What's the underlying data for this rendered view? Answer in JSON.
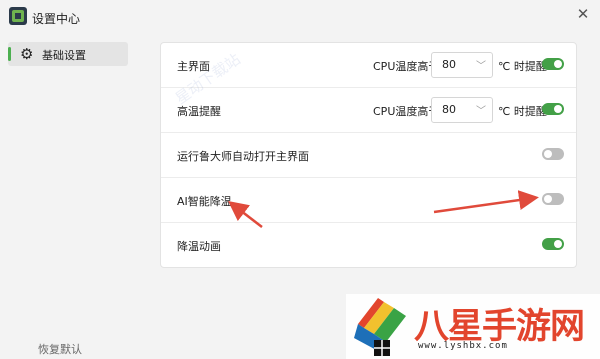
{
  "window": {
    "title": "设置中心",
    "close_glyph": "✕"
  },
  "sidebar": {
    "items": [
      {
        "label": "基础设置",
        "icon": "gear-icon",
        "selected": true
      }
    ],
    "restore_label": "恢复默认"
  },
  "settings": {
    "main_ui": {
      "label": "主界面",
      "cpu_label": "CPU温度高于",
      "threshold": "80",
      "unit_label": "℃ 时提醒",
      "enabled": true
    },
    "high_temp_alert": {
      "label": "高温提醒",
      "cpu_label": "CPU温度高于",
      "threshold": "80",
      "unit_label": "℃ 时提醒",
      "enabled": true
    },
    "auto_open": {
      "label": "运行鲁大师自动打开主界面",
      "enabled": false
    },
    "ai_cooling": {
      "label": "AI智能降温",
      "enabled": false
    },
    "cooling_animation": {
      "label": "降温动画",
      "enabled": true
    }
  },
  "watermark": {
    "text": "星动下载站"
  },
  "logo": {
    "text": "八星手游网",
    "url": "www.lyshbx.com"
  },
  "colors": {
    "accent_green": "#43a047",
    "toggle_off": "#bdbdbd",
    "annotation_red": "#e04a3b",
    "logo_red": "#e2452d"
  }
}
